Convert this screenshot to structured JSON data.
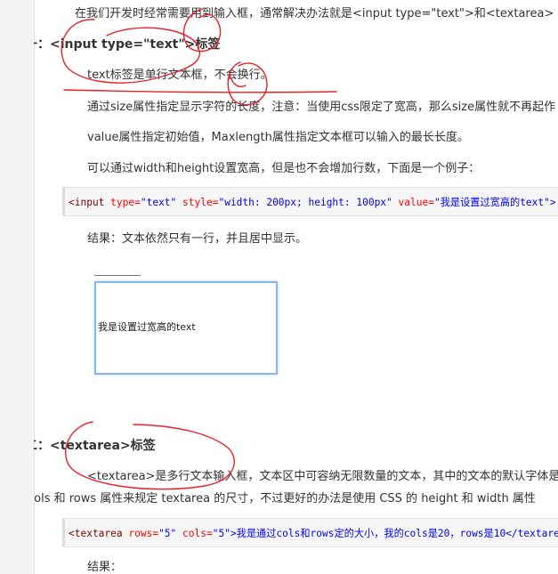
{
  "intro": "在我们开发时经常需要用到输入框，通常解决办法就是<input type=\"text\">和<textarea>",
  "section1": {
    "heading_prefix": "一：",
    "heading_code": "<input type=\"text\">",
    "heading_suffix": "标签",
    "lines": [
      "text标签是单行文本框，不会换行。",
      "通过size属性指定显示字符的长度，注意：当使用css限定了宽高，那么size属性就不再起作",
      "value属性指定初始值，Maxlength属性指定文本框可以输入的最长长度。",
      "可以通过width和height设置宽高，但是也不会增加行数，下面是一个例子："
    ],
    "code": {
      "open": "<input",
      "attr1": "type=",
      "val1": "\"text\"",
      "attr2": "style=",
      "val2": "\"width: 200px; height: 100px\"",
      "attr3": "value=",
      "val3": "\"我是设置过宽高的text\">"
    },
    "result": "结果：文本依然只有一行，并且居中显示。",
    "demo_value": "我是设置过宽高的text"
  },
  "section2": {
    "heading_prefix": "二：",
    "heading_code": "<textarea>",
    "heading_suffix": "标签",
    "line1": "<textarea>是多行文本输入框，文本区中可容纳无限数量的文本，其中的文本的默认字体是等宽字",
    "line2": "cols 和 rows 属性来规定 textarea 的尺寸，不过更好的办法是使用 CSS 的 height 和 width 属性",
    "code": {
      "open": "<textarea",
      "attr1": "rows=",
      "val1": "\"5\"",
      "attr2": "cols=",
      "val2": "\"5\">",
      "text": "我是通过cols和rows定的大小，我的cols是20，rows是10</textarea>"
    },
    "result": "结果："
  },
  "colors": {
    "annotation": "#e8202a",
    "tag": "#800000",
    "attr": "#ff0000",
    "string": "#0000ff"
  }
}
